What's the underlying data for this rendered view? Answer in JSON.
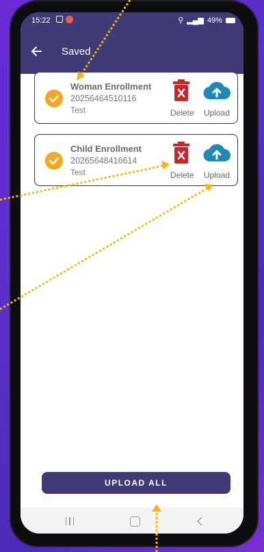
{
  "status": {
    "time": "15:22",
    "battery": "49%"
  },
  "appbar": {
    "title": "Saved",
    "back_icon": "arrow-left-icon"
  },
  "records": [
    {
      "name": "Woman Enrollment",
      "id": "20256464510116",
      "note": "Test",
      "delete_label": "Delete",
      "upload_label": "Upload"
    },
    {
      "name": "Child Enrollment",
      "id": "20265648416614",
      "note": "Test",
      "delete_label": "Delete",
      "upload_label": "Upload"
    }
  ],
  "footer": {
    "upload_all_label": "UPLOAD ALL"
  },
  "colors": {
    "primary": "#3f3a78",
    "check": "#f5a623",
    "delete": "#c62828",
    "upload": "#1e88b8",
    "annotation": "#f5b70a"
  }
}
